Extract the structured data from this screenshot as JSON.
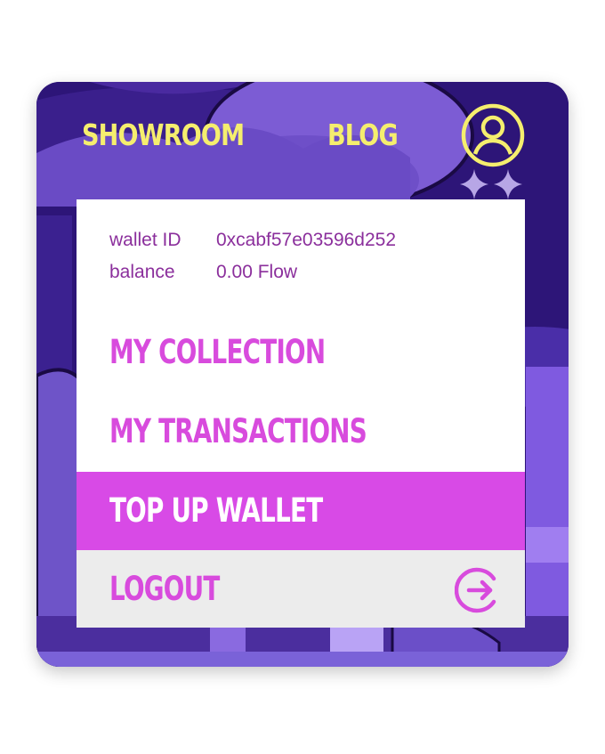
{
  "nav": {
    "showroom": "SHOWROOM",
    "blog": "BLOG",
    "profile_icon": "user-circle-icon",
    "sparkle_icon": "sparkles-icon"
  },
  "wallet": {
    "id_label": "wallet ID",
    "id_value": "0xcabf57e03596d252",
    "balance_label": "balance",
    "balance_value": "0.00 Flow"
  },
  "menu": {
    "collection": "MY COLLECTION",
    "transactions": "MY TRANSACTIONS",
    "top_up": "TOP UP WALLET",
    "logout": "LOGOUT",
    "logout_icon": "logout-arrow-icon"
  },
  "colors": {
    "nav_text": "#f5ee6e",
    "menu_text": "#d84bdd",
    "active_bg": "#d84ae6",
    "info_text": "#8b2f9c",
    "background": "#2b1376"
  }
}
